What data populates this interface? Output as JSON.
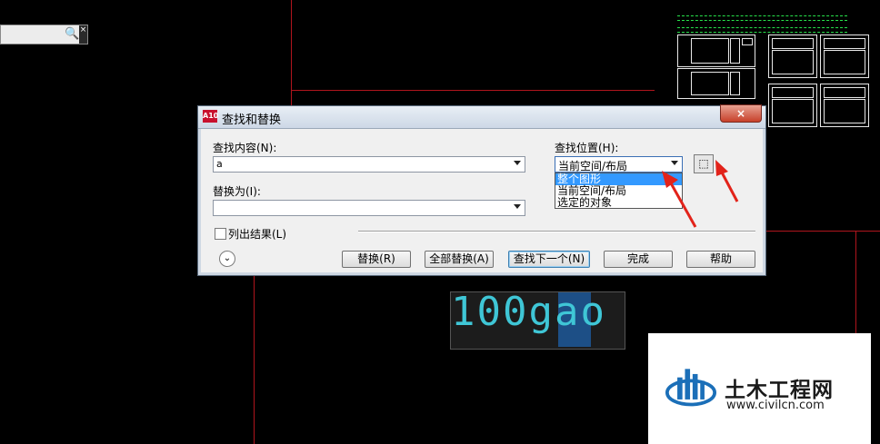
{
  "mini_search": {
    "icon": "binoculars-icon",
    "close": "×"
  },
  "dialog": {
    "title": "查找和替换",
    "app_icon_text": "A10",
    "close_label": "×",
    "find_label": "查找内容(N):",
    "find_value": "a",
    "replace_label": "替换为(I):",
    "replace_value": "",
    "where_label": "查找位置(H):",
    "where_value": "当前空间/布局",
    "where_options": [
      "整个图形",
      "当前空间/布局",
      "选定的对象"
    ],
    "list_results_label": "列出结果(L)",
    "buttons": {
      "replace": "替换(R)",
      "replace_all": "全部替换(A)",
      "find_next": "查找下一个(N)",
      "done": "完成",
      "help": "帮助"
    }
  },
  "preview_text": "100gao",
  "watermark": {
    "title": "土木工程网",
    "url": "www.civilcn.com"
  },
  "colors": {
    "cad_background": "#000000",
    "red_line": "#b0151d",
    "preview_text": "#3fc6d6",
    "annotation_arrow": "#e2231a"
  }
}
